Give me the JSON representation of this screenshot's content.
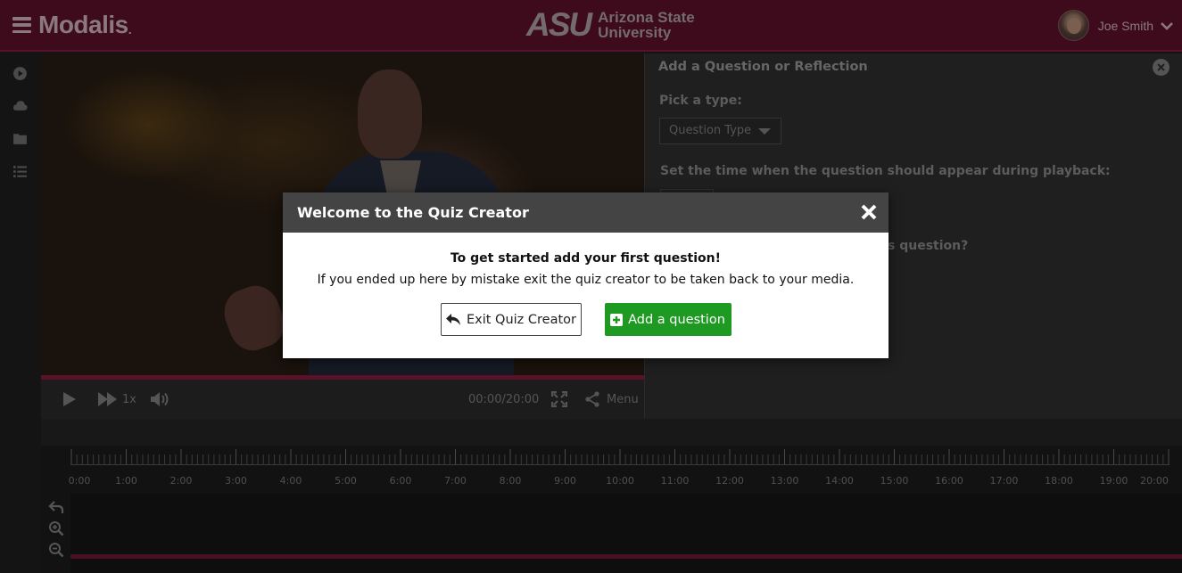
{
  "header": {
    "brand": "Modalis",
    "brand_suffix": ".",
    "institution_mark": "ASU",
    "institution_line1": "Arizona State",
    "institution_line2": "University",
    "user_name": "Joe Smith"
  },
  "sidebar": {
    "icons": [
      "play-circle-icon",
      "cloud-icon",
      "folder-icon",
      "list-icon"
    ]
  },
  "player": {
    "speed": "1x",
    "time": "00:00/20:00",
    "menu_label": "Menu"
  },
  "panel": {
    "title": "Add a Question or Reflection",
    "pick_label": "Pick a type:",
    "question_type_value": "Question Type",
    "time_label": "Set the time when the question should appear during playback:",
    "partial_question_text": "s question?"
  },
  "timeline": {
    "labels": [
      "0:00",
      "1:00",
      "2:00",
      "3:00",
      "4:00",
      "5:00",
      "6:00",
      "7:00",
      "8:00",
      "9:00",
      "10:00",
      "11:00",
      "12:00",
      "13:00",
      "14:00",
      "15:00",
      "16:00",
      "17:00",
      "18:00",
      "19:00",
      "20:00"
    ]
  },
  "modal": {
    "title": "Welcome to the Quiz Creator",
    "lead": "To get started add your first question!",
    "sub": "If you ended up here by mistake exit the quiz creator to be taken back to your media.",
    "exit_label": "Exit Quiz Creator",
    "add_label": "Add a question"
  },
  "colors": {
    "header_bg": "#3e0b1c",
    "accent": "#5a1228",
    "add_button": "#1e9a22",
    "modal_header": "#444444"
  }
}
